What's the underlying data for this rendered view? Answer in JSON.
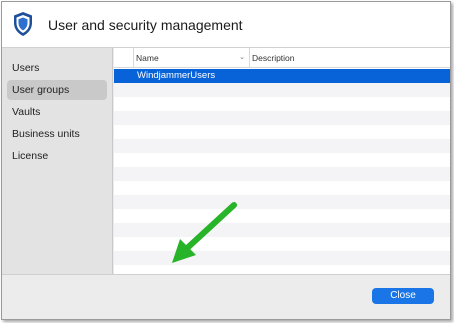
{
  "dialog": {
    "title": "User and security management",
    "icon": "shield-icon"
  },
  "sidebar": {
    "items": [
      {
        "label": "Users",
        "active": false
      },
      {
        "label": "User groups",
        "active": true
      },
      {
        "label": "Vaults",
        "active": false
      },
      {
        "label": "Business units",
        "active": false
      },
      {
        "label": "License",
        "active": false
      }
    ]
  },
  "table": {
    "columns": [
      "Name",
      "Description"
    ],
    "rows": [
      {
        "name": "WindjammerUsers",
        "description": "",
        "selected": true
      }
    ]
  },
  "toolbar": {
    "buttons": [
      {
        "name": "add-button",
        "glyph": "+"
      },
      {
        "name": "remove-button",
        "glyph": "−"
      },
      {
        "name": "permissions-button",
        "glyph": "shield"
      },
      {
        "name": "members-button",
        "glyph": "users"
      },
      {
        "name": "refresh-button",
        "glyph": "↻"
      }
    ]
  },
  "footer": {
    "close_label": "Close"
  },
  "annotation": {
    "arrow_color": "#28b428"
  },
  "colors": {
    "accent": "#0963d8",
    "close_button": "#1a75e6"
  }
}
